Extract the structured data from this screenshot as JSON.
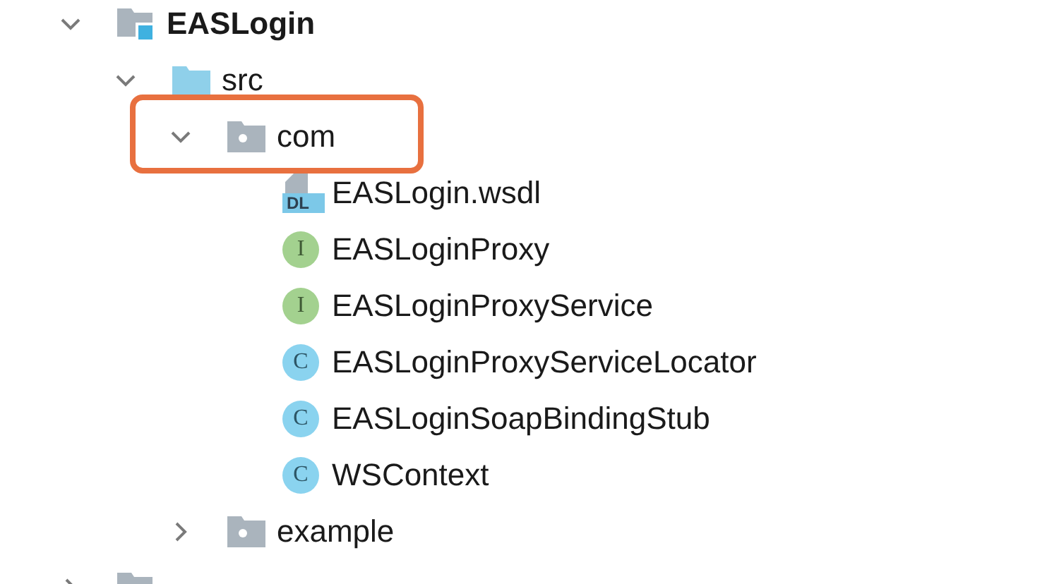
{
  "tree": [
    {
      "label": "EASLogin",
      "kind": "module",
      "expanded": true,
      "children": [
        {
          "label": "src",
          "kind": "source-folder",
          "expanded": true,
          "children": [
            {
              "label": "com",
              "kind": "package",
              "expanded": true,
              "highlighted": true,
              "children": [
                {
                  "label": "EASLogin.wsdl",
                  "kind": "wsdl",
                  "icon_letter": "DL"
                },
                {
                  "label": "EASLoginProxy",
                  "kind": "interface",
                  "icon_letter": "I"
                },
                {
                  "label": "EASLoginProxyService",
                  "kind": "interface",
                  "icon_letter": "I"
                },
                {
                  "label": "EASLoginProxyServiceLocator",
                  "kind": "class",
                  "icon_letter": "C"
                },
                {
                  "label": "EASLoginSoapBindingStub",
                  "kind": "class",
                  "icon_letter": "C"
                },
                {
                  "label": "WSContext",
                  "kind": "class",
                  "icon_letter": "C"
                }
              ]
            },
            {
              "label": "example",
              "kind": "package",
              "expanded": false,
              "highlighted": false
            }
          ]
        }
      ]
    },
    {
      "kind": "module",
      "expanded": false
    }
  ]
}
